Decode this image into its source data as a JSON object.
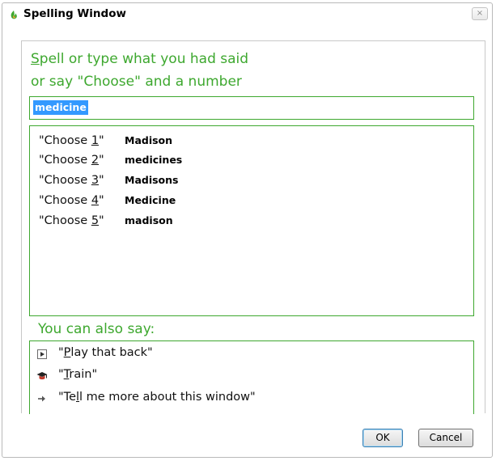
{
  "window": {
    "title": "Spelling Window",
    "close_label": "×"
  },
  "prompt": {
    "line1_underlined": "S",
    "line1_rest": "pell or type what you had said",
    "line2": "or say \"Choose\" and a number"
  },
  "spell_input": {
    "value": "medicine"
  },
  "choices": [
    {
      "prefix": "\"Choose ",
      "number": "1",
      "suffix": "\"",
      "word": "Madison"
    },
    {
      "prefix": "\"Choose ",
      "number": "2",
      "suffix": "\"",
      "word": "medicines"
    },
    {
      "prefix": "\"Choose ",
      "number": "3",
      "suffix": "\"",
      "word": "Madisons"
    },
    {
      "prefix": "\"Choose ",
      "number": "4",
      "suffix": "\"",
      "word": "Medicine"
    },
    {
      "prefix": "\"Choose ",
      "number": "5",
      "suffix": "\"",
      "word": "madison"
    }
  ],
  "also": {
    "heading": "You can also say:",
    "items": [
      {
        "pre": "\"",
        "ul": "P",
        "post": "lay that back\"",
        "icon": "play-icon"
      },
      {
        "pre": "\"",
        "ul": "T",
        "post": "rain\"",
        "icon": "graduation-cap-icon"
      },
      {
        "pre": "\"Te",
        "ul": "l",
        "post": "l me more about this window\"",
        "icon": "arrow-right-icon"
      }
    ]
  },
  "buttons": {
    "ok": "OK",
    "cancel": "Cancel"
  },
  "colors": {
    "accent": "#3ea82f",
    "selection": "#3399ff"
  }
}
